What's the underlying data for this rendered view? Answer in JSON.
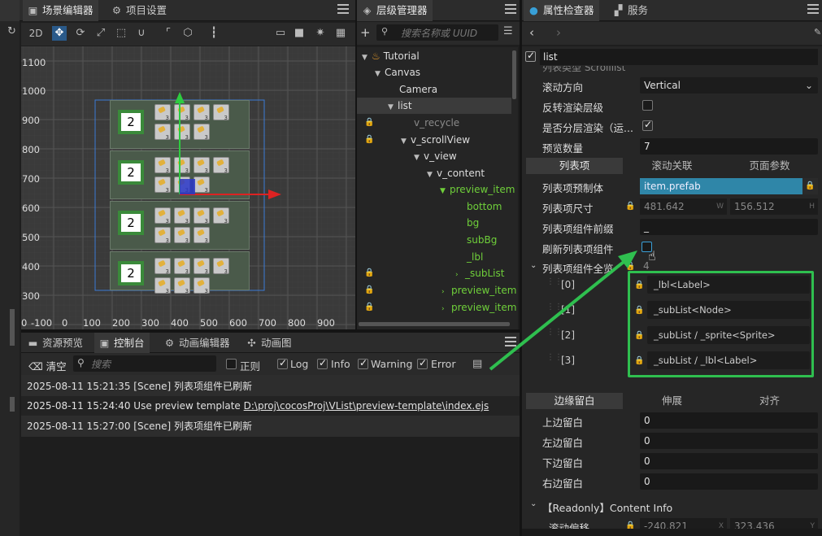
{
  "scene_tabs": {
    "scene": "场景编辑器",
    "project": "项目设置"
  },
  "hierarchy_tab": "层级管理器",
  "inspector_tabs": {
    "inspector": "属性检查器",
    "services": "服务"
  },
  "scene_toolbar": {
    "mode": "2D"
  },
  "hierarchy": {
    "search_placeholder": "搜索名称或 UUID",
    "nodes": [
      {
        "label": "Tutorial"
      },
      {
        "label": "Canvas"
      },
      {
        "label": "Camera"
      },
      {
        "label": "list"
      },
      {
        "label": "v_recycle"
      },
      {
        "label": "v_scrollView"
      },
      {
        "label": "v_view"
      },
      {
        "label": "v_content"
      },
      {
        "label": "preview_item"
      },
      {
        "label": "bottom"
      },
      {
        "label": "bg"
      },
      {
        "label": "subBg"
      },
      {
        "label": "_lbl"
      },
      {
        "label": "_subList"
      },
      {
        "label": "preview_item"
      },
      {
        "label": "preview_item"
      }
    ]
  },
  "grid_labels": {
    "y": [
      "1100",
      "1000",
      "900",
      "800",
      "700",
      "600",
      "500",
      "400",
      "300",
      "200",
      "100"
    ],
    "x": [
      "0",
      "-100",
      "0",
      "100",
      "200",
      "300",
      "400",
      "500",
      "600",
      "700",
      "800",
      "900"
    ]
  },
  "scene_numbers": [
    "2",
    "2",
    "2",
    "2"
  ],
  "bottom_tabs": {
    "assets": "资源预览",
    "console": "控制台",
    "anim": "动画编辑器",
    "animgraph": "动画图"
  },
  "console": {
    "clear": "清空",
    "search_placeholder": "搜索",
    "regex": "正则",
    "filters": {
      "log": "Log",
      "info": "Info",
      "warning": "Warning",
      "error": "Error"
    },
    "logs": [
      {
        "time": "2025-08-11 15:21:35",
        "msg": "[Scene] 列表项组件已刷新"
      },
      {
        "time": "2025-08-11 15:24:40",
        "msg": "Use preview template",
        "link": "D:\\proj\\cocosProj\\VList\\preview-template\\index.ejs"
      },
      {
        "time": "2025-08-11 15:27:00",
        "msg": "[Scene] 列表项组件已刷新"
      }
    ]
  },
  "inspector": {
    "component": "list",
    "cut_top": "列表类型 Scrolllist",
    "props": [
      {
        "label": "滚动方向",
        "value": "Vertical"
      },
      {
        "label": "反转渲染层级"
      },
      {
        "label": "是否分层渲染（运..."
      },
      {
        "label": "预览数量",
        "value": "7"
      }
    ],
    "tabs1": [
      "列表项",
      "滚动关联",
      "页面参数"
    ],
    "item_prefab_label": "列表项预制体",
    "item_prefab_value": "item.prefab",
    "item_size_label": "列表项尺寸",
    "item_size_w": "481.642",
    "item_size_h": "156.512",
    "w": "W",
    "h": "H",
    "prefix_label": "列表项组件前缀",
    "prefix_value": "_",
    "refresh_label": "刷新列表项组件",
    "all_label": "列表项组件全览",
    "all_count": "4",
    "all_items": [
      {
        "idx": "[0]",
        "value": "_lbl<Label>"
      },
      {
        "idx": "[1]",
        "value": "_subList<Node>"
      },
      {
        "idx": "[2]",
        "value": "_subList / _sprite<Sprite>"
      },
      {
        "idx": "[3]",
        "value": "_subList / _lbl<Label>"
      }
    ],
    "tabs2": [
      "边缘留白",
      "伸展",
      "对齐"
    ],
    "margins": [
      {
        "label": "上边留白",
        "value": "0"
      },
      {
        "label": "左边留白",
        "value": "0"
      },
      {
        "label": "下边留白",
        "value": "0"
      },
      {
        "label": "右边留白",
        "value": "0"
      }
    ],
    "content_info": "【Readonly】Content Info",
    "scroll_offset_label": "滚动偏移",
    "scroll_x": "-240.821",
    "scroll_y": "323.436",
    "x": "X",
    "y": "Y"
  },
  "colors": {
    "accent_green": "#2fbf4f",
    "selection_blue": "#2f86a8",
    "node_green": "#6fcf3a"
  }
}
